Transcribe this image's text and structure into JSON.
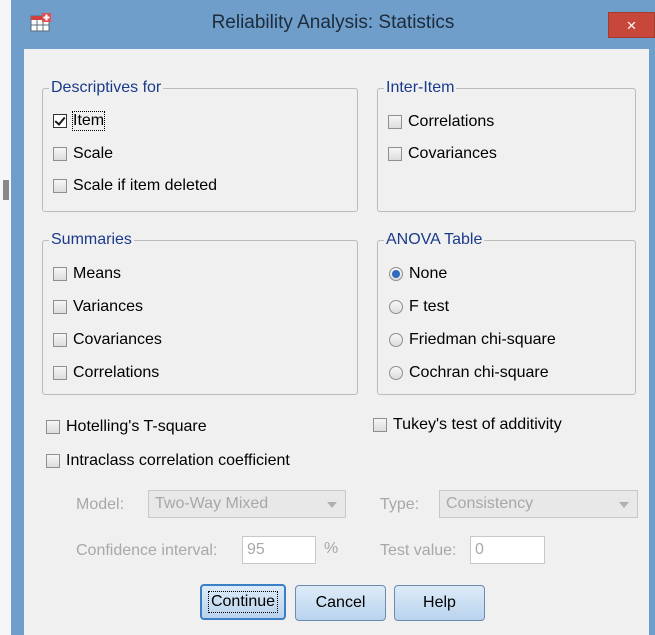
{
  "window": {
    "title": "Reliability Analysis: Statistics",
    "close_glyph": "×",
    "icon": "spss-table-icon"
  },
  "descriptives": {
    "legend": "Descriptives for",
    "items": [
      {
        "label": "Item",
        "checked": true
      },
      {
        "label": "Scale",
        "checked": false
      },
      {
        "label": "Scale if item deleted",
        "checked": false
      }
    ]
  },
  "inter_item": {
    "legend": "Inter-Item",
    "items": [
      {
        "label": "Correlations",
        "checked": false
      },
      {
        "label": "Covariances",
        "checked": false
      }
    ]
  },
  "summaries": {
    "legend": "Summaries",
    "items": [
      {
        "label": "Means",
        "checked": false
      },
      {
        "label": "Variances",
        "checked": false
      },
      {
        "label": "Covariances",
        "checked": false
      },
      {
        "label": "Correlations",
        "checked": false
      }
    ]
  },
  "anova": {
    "legend": "ANOVA Table",
    "options": [
      {
        "label": "None",
        "selected": true
      },
      {
        "label": "F test",
        "selected": false
      },
      {
        "label": "Friedman chi-square",
        "selected": false
      },
      {
        "label": "Cochran chi-square",
        "selected": false
      }
    ]
  },
  "hotelling": {
    "label": "Hotelling's T-square",
    "checked": false
  },
  "tukey": {
    "label": "Tukey's test of additivity",
    "checked": false
  },
  "intraclass": {
    "label": "Intraclass correlation coefficient",
    "checked": false
  },
  "model": {
    "label": "Model:",
    "value": "Two-Way Mixed"
  },
  "type": {
    "label": "Type:",
    "value": "Consistency"
  },
  "confidence": {
    "label": "Confidence interval:",
    "value": "95",
    "unit": "%"
  },
  "test_value": {
    "label": "Test value:",
    "value": "0"
  },
  "buttons": {
    "continue": "Continue",
    "cancel": "Cancel",
    "help": "Help"
  },
  "colors": {
    "frame": "#6f9ecb",
    "close": "#c7483b",
    "legend_text": "#1a3a8a",
    "button": "#c9def4"
  }
}
